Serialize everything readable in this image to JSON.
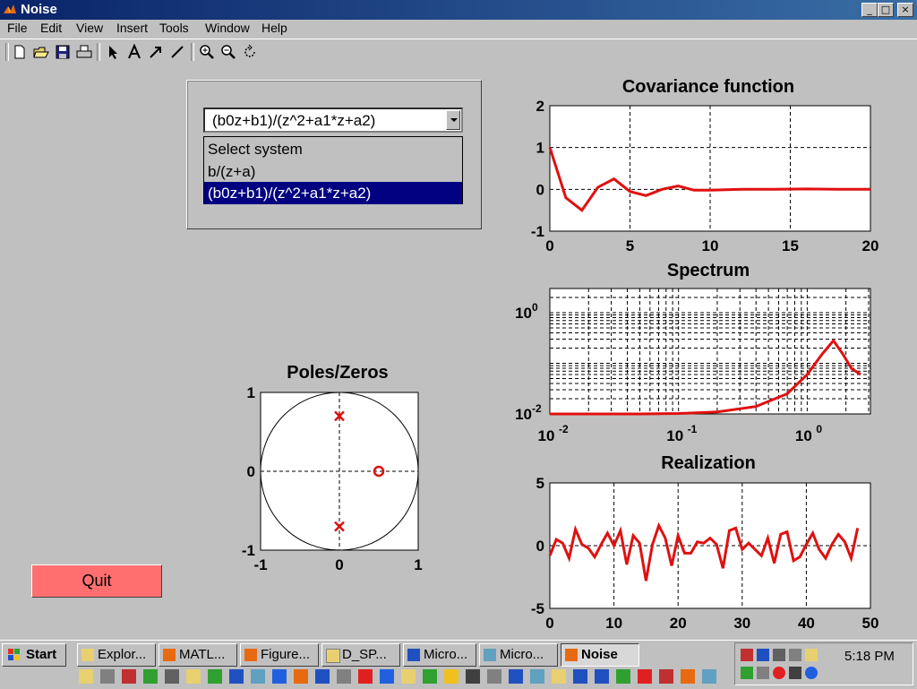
{
  "window": {
    "title": "Noise",
    "minimize": "_",
    "maximize": "□",
    "close": "×"
  },
  "menu": [
    "File",
    "Edit",
    "View",
    "Insert",
    "Tools",
    "Window",
    "Help"
  ],
  "toolbar": [
    "new-file-icon",
    "open-icon",
    "save-icon",
    "print-icon",
    "arrow-select-icon",
    "text-icon",
    "arrow-tool-icon",
    "line-tool-icon",
    "zoom-in-icon",
    "zoom-out-icon",
    "rotate-icon"
  ],
  "combo": {
    "selected": "(b0z+b1)/(z^2+a1*z+a2)",
    "options": [
      "Select system",
      "b/(z+a)",
      "(b0z+b1)/(z^2+a1*z+a2)"
    ],
    "highlighted_index": 2
  },
  "quit_label": "Quit",
  "colors": {
    "line": "#e01010",
    "quit": "#ff6f6f",
    "selection": "#000080"
  },
  "chart_data": [
    {
      "type": "line",
      "title": "Covariance function",
      "xlim": [
        0,
        20
      ],
      "ylim": [
        -1,
        2
      ],
      "xticks": [
        "0",
        "5",
        "10",
        "15",
        "20"
      ],
      "yticks": [
        "2",
        "1",
        "0",
        "-1"
      ],
      "grid": true,
      "x": [
        0,
        1,
        2,
        3,
        4,
        5,
        6,
        7,
        8,
        9,
        10,
        12,
        14,
        16,
        18,
        20
      ],
      "y": [
        1.0,
        -0.2,
        -0.5,
        0.05,
        0.25,
        -0.05,
        -0.15,
        0.0,
        0.08,
        -0.02,
        -0.02,
        0.0,
        0.0,
        0.01,
        0.0,
        0.0
      ]
    },
    {
      "type": "line",
      "title": "Spectrum",
      "log_scale": true,
      "xlim": [
        0.01,
        3.1
      ],
      "ylim": [
        0.01,
        3
      ],
      "xticks": [
        "10",
        "10",
        "10"
      ],
      "xtick_exponents": [
        "-2",
        "-1",
        "0"
      ],
      "yticks": [
        "10",
        "10"
      ],
      "ytick_exponents": [
        "0",
        "-2"
      ],
      "grid": true,
      "x": [
        0.01,
        0.05,
        0.1,
        0.2,
        0.4,
        0.7,
        1.0,
        1.3,
        1.6,
        1.9,
        2.2,
        2.6
      ],
      "y": [
        0.01,
        0.01,
        0.0102,
        0.011,
        0.014,
        0.025,
        0.06,
        0.15,
        0.28,
        0.15,
        0.08,
        0.06
      ]
    },
    {
      "type": "line",
      "title": "Realization",
      "xlim": [
        0,
        50
      ],
      "ylim": [
        -5,
        5
      ],
      "xticks": [
        "0",
        "10",
        "20",
        "30",
        "40",
        "50"
      ],
      "yticks": [
        "5",
        "0",
        "-5"
      ],
      "grid": true,
      "x": [
        0,
        1,
        2,
        3,
        4,
        5,
        6,
        7,
        8,
        9,
        10,
        11,
        12,
        13,
        14,
        15,
        16,
        17,
        18,
        19,
        20,
        21,
        22,
        23,
        24,
        25,
        26,
        27,
        28,
        29,
        30,
        31,
        32,
        33,
        34,
        35,
        36,
        37,
        38,
        39,
        40,
        41,
        42,
        43,
        44,
        45,
        46,
        47,
        48,
        49
      ],
      "y": [
        -0.8,
        0.5,
        0.2,
        -1.0,
        1.3,
        0.1,
        -0.2,
        -0.9,
        0.1,
        1.0,
        0.0,
        1.2,
        -1.5,
        0.8,
        0.2,
        -2.8,
        0.1,
        1.6,
        0.6,
        -1.6,
        0.8,
        -0.6,
        -0.6,
        0.3,
        0.2,
        0.6,
        0.1,
        -1.8,
        1.2,
        1.4,
        -0.3,
        0.2,
        -0.3,
        -0.8,
        0.6,
        -1.4,
        0.9,
        1.1,
        -1.2,
        -0.9,
        0.1,
        1.0,
        -0.3,
        -1.0,
        0.1,
        0.9,
        0.3,
        -1.0,
        1.4
      ]
    },
    {
      "type": "scatter",
      "title": "Poles/Zeros",
      "xlim": [
        -1,
        1
      ],
      "ylim": [
        -1,
        1
      ],
      "xticks": [
        "-1",
        "0",
        "1"
      ],
      "yticks": [
        "1",
        "0",
        "-1"
      ],
      "unit_circle": true,
      "poles": [
        [
          0.0,
          0.7
        ],
        [
          0.0,
          -0.7
        ]
      ],
      "zeros": [
        [
          0.5,
          0.0
        ]
      ]
    }
  ],
  "taskbar": {
    "start": "Start",
    "tasks": [
      {
        "label": "Explor...",
        "icon": "explorer-icon"
      },
      {
        "label": "MATL...",
        "icon": "matlab-icon"
      },
      {
        "label": "Figure...",
        "icon": "matlab-figure-icon"
      },
      {
        "label": "D_SP...",
        "icon": "folder-icon"
      },
      {
        "label": "Micro...",
        "icon": "word-icon"
      },
      {
        "label": "Micro...",
        "icon": "window-icon"
      },
      {
        "label": "Noise",
        "icon": "matlab-figure-icon",
        "active": true
      }
    ],
    "clock": "5:18 PM"
  }
}
